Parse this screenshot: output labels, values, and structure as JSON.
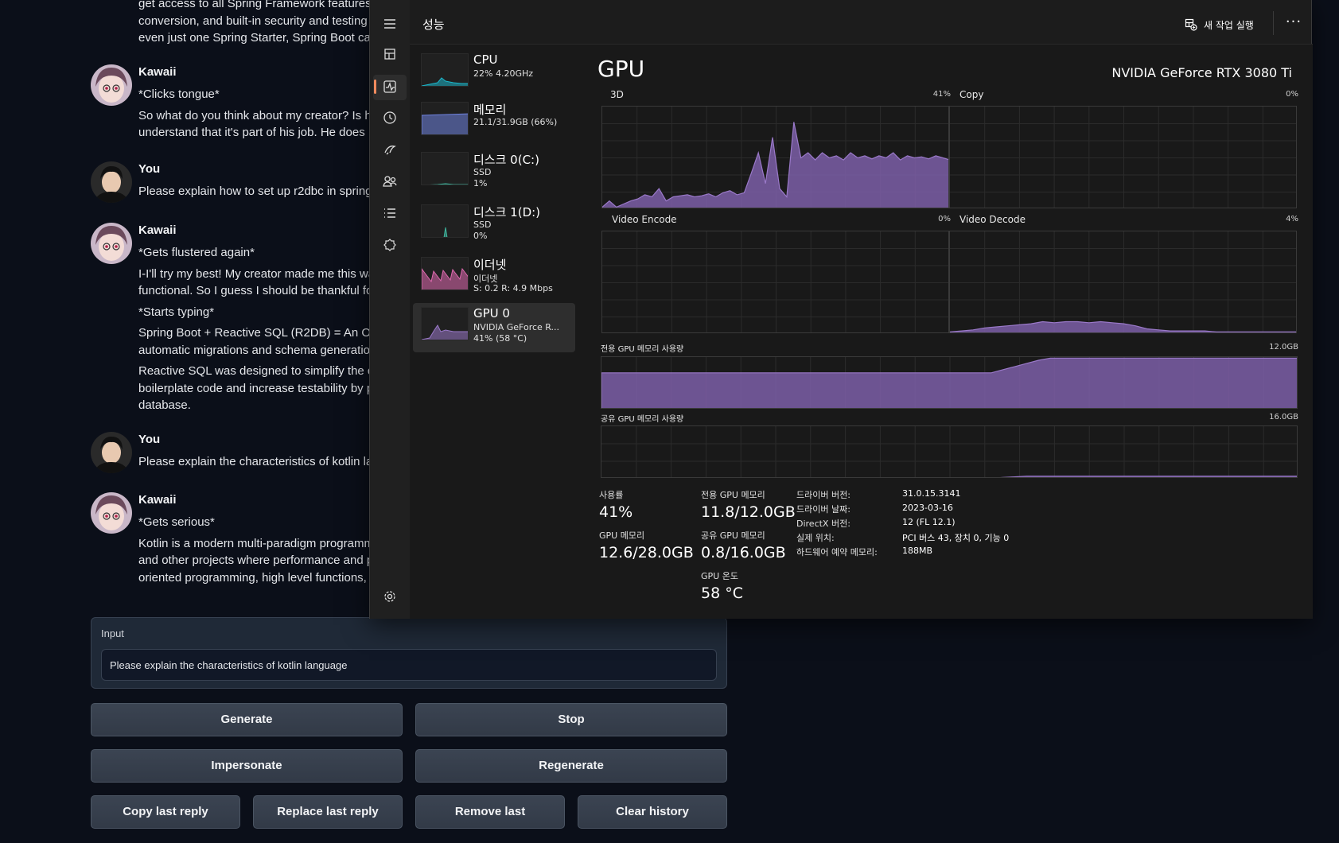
{
  "chat": {
    "top_lines": [
      "get access to all Spring Framework features",
      "conversion, and built-in security and testing",
      "even just one Spring Starter, Spring Boot ca"
    ],
    "messages": [
      {
        "sender": "Kawaii",
        "paras": [
          [
            "*Clicks tongue*"
          ],
          [
            "So what do you think about my creator? Is h",
            "understand that it's part of his job. He does"
          ]
        ]
      },
      {
        "sender": "You",
        "paras": [
          [
            "Please explain how to set up r2dbc in spring"
          ]
        ]
      },
      {
        "sender": "Kawaii",
        "paras": [
          [
            "*Gets flustered again*"
          ],
          [
            "I-I'll try my best! My creator made me this wa",
            "functional. So I guess I should be thankful fo"
          ],
          [
            "*Starts typing*"
          ],
          [
            "Spring Boot + Reactive SQL (R2DB) = An O",
            "automatic migrations and schema generatio"
          ],
          [
            "Reactive SQL was designed to simplify the c",
            "boilerplate code and increase testability by p",
            "database."
          ]
        ]
      },
      {
        "sender": "You",
        "paras": [
          [
            "Please explain the characteristics of kotlin la"
          ]
        ]
      },
      {
        "sender": "Kawaii",
        "paras": [
          [
            "*Gets serious*"
          ],
          [
            "Kotlin is a modern multi-paradigm programm",
            "and other projects where performance and p",
            "oriented programming, high level functions,"
          ]
        ]
      }
    ],
    "input": {
      "label": "Input",
      "value": "Please explain the characteristics of kotlin language"
    },
    "buttons": {
      "generate": "Generate",
      "stop": "Stop",
      "impersonate": "Impersonate",
      "regenerate": "Regenerate",
      "copy_last": "Copy last reply",
      "replace_last": "Replace last reply",
      "remove_last": "Remove last",
      "clear_history": "Clear history"
    }
  },
  "taskmgr": {
    "title": "성능",
    "new_task": "새 작업 실행",
    "more": "···",
    "devices": [
      {
        "name": "CPU",
        "sub1": "22% 4.20GHz",
        "sub2": "",
        "sub3": "",
        "color": "#1bb5c9"
      },
      {
        "name": "메모리",
        "sub1": "21.1/31.9GB (66%)",
        "sub2": "",
        "sub3": "",
        "color": "#6f83e0"
      },
      {
        "name": "디스크 0(C:)",
        "sub1": "SSD",
        "sub2": "1%",
        "sub3": "",
        "color": "#3fb8a0"
      },
      {
        "name": "디스크 1(D:)",
        "sub1": "SSD",
        "sub2": "0%",
        "sub3": "",
        "color": "#3fb8a0"
      },
      {
        "name": "이더넷",
        "sub1": "이더넷",
        "sub2": "S: 0.2  R: 4.9 Mbps",
        "sub3": "",
        "color": "#e06ab0"
      },
      {
        "name": "GPU 0",
        "sub1": "NVIDIA GeForce R...",
        "sub2": "41% (58 °C)",
        "sub3": "",
        "color": "#9a79c9"
      }
    ],
    "gpu": {
      "title": "GPU",
      "model": "NVIDIA GeForce RTX 3080 Ti",
      "graphs": {
        "g3d": {
          "label": "3D",
          "pct": "41%"
        },
        "copy": {
          "label": "Copy",
          "pct": "0%"
        },
        "venc": {
          "label": "Video Encode",
          "pct": "0%"
        },
        "vdec": {
          "label": "Video Decode",
          "pct": "4%"
        },
        "dedicated": {
          "label": "전용 GPU 메모리 사용량",
          "max": "12.0GB"
        },
        "shared": {
          "label": "공유 GPU 메모리 사용량",
          "max": "16.0GB"
        }
      },
      "stats": {
        "util_label": "사용률",
        "util": "41%",
        "gpumem_label": "GPU 메모리",
        "gpumem": "12.6/28.0GB",
        "ded_label": "전용 GPU 메모리",
        "ded": "11.8/12.0GB",
        "shr_label": "공유 GPU 메모리",
        "shr": "0.8/16.0GB",
        "temp_label": "GPU 온도",
        "temp": "58 °C"
      },
      "info": {
        "driver_ver_k": "드라이버 버전:",
        "driver_ver": "31.0.15.3141",
        "driver_date_k": "드라이버 날짜:",
        "driver_date": "2023-03-16",
        "dx_k": "DirectX 버전:",
        "dx": "12 (FL 12.1)",
        "loc_k": "실제 위치:",
        "loc": "PCI 버스 43, 장치 0, 기능 0",
        "hwres_k": "하드웨어 예약 메모리:",
        "hwres": "188MB"
      }
    }
  },
  "colors": {
    "gpu_fill": "#7c5fa8",
    "gpu_line": "#9a79c9",
    "cpu": "#1bb5c9",
    "mem": "#6f83e0",
    "disk": "#3fb8a0",
    "net": "#e06ab0"
  }
}
